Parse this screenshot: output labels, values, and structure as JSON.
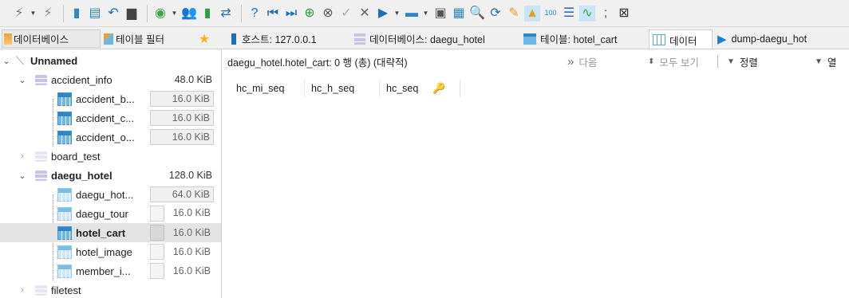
{
  "toolbar": {
    "icons": [
      "plug-icon",
      "plug-disconnect-icon",
      "database-icon",
      "refresh-icon",
      "undo-icon",
      "print-icon",
      "power-icon",
      "users-icon",
      "database-green-icon",
      "merge-icon",
      "help-icon",
      "first-record-icon",
      "last-record-icon",
      "add-record-icon",
      "delete-record-icon",
      "check-icon",
      "cancel-icon",
      "play-icon",
      "folder-icon",
      "save-icon",
      "grid-icon",
      "search-icon",
      "search-refresh-icon",
      "broom-icon",
      "warning-icon",
      "binary-icon",
      "wrap-icon",
      "chart-icon",
      "semicolon-icon",
      "close-box-icon"
    ]
  },
  "tabs": [
    {
      "label": "데이터베이스",
      "icon": "database-filter-icon"
    },
    {
      "label": "테이블 필터",
      "icon": "table-filter-icon"
    },
    {
      "label": "",
      "icon": "star-icon"
    },
    {
      "label": "호스트: 127.0.0.1",
      "icon": "host-icon"
    },
    {
      "label": "데이터베이스: daegu_hotel",
      "icon": "database-icon"
    },
    {
      "label": "테이블: hotel_cart",
      "icon": "table-icon"
    },
    {
      "label": "데이터",
      "icon": "data-grid-icon"
    },
    {
      "label": "dump-daegu_hot",
      "icon": "query-play-icon"
    }
  ],
  "sidebar": {
    "session": {
      "label": "Unnamed"
    },
    "databases": [
      {
        "name": "accident_info",
        "size": "48.0 KiB",
        "expanded": true,
        "tables": [
          {
            "name": "accident_b...",
            "size": "16.0 KiB"
          },
          {
            "name": "accident_c...",
            "size": "16.0 KiB"
          },
          {
            "name": "accident_o...",
            "size": "16.0 KiB"
          }
        ]
      },
      {
        "name": "board_test",
        "size": "",
        "expanded": false,
        "tables": []
      },
      {
        "name": "daegu_hotel",
        "size": "128.0 KiB",
        "expanded": true,
        "tables": [
          {
            "name": "daegu_hot...",
            "size": "64.0 KiB"
          },
          {
            "name": "daegu_tour",
            "size": "16.0 KiB"
          },
          {
            "name": "hotel_cart",
            "size": "16.0 KiB",
            "selected": true
          },
          {
            "name": "hotel_image",
            "size": "16.0 KiB"
          },
          {
            "name": "member_i...",
            "size": "16.0 KiB"
          }
        ]
      },
      {
        "name": "filetest",
        "size": "",
        "expanded": false,
        "tables": []
      }
    ]
  },
  "content": {
    "info_label": "daegu_hotel.hotel_cart: 0 행 (총) (대략적)",
    "next_label": "다음",
    "show_all_label": "모두 보기",
    "sort_label": "정렬",
    "filter_label": "열"
  },
  "grid": {
    "columns": [
      "hc_mi_seq",
      "hc_h_seq",
      "hc_seq"
    ],
    "rows": []
  },
  "colors": {
    "accent": "#2f86c6",
    "selected_row": "#e3e3e3",
    "toolbar_bg": "#f0f0f0"
  }
}
